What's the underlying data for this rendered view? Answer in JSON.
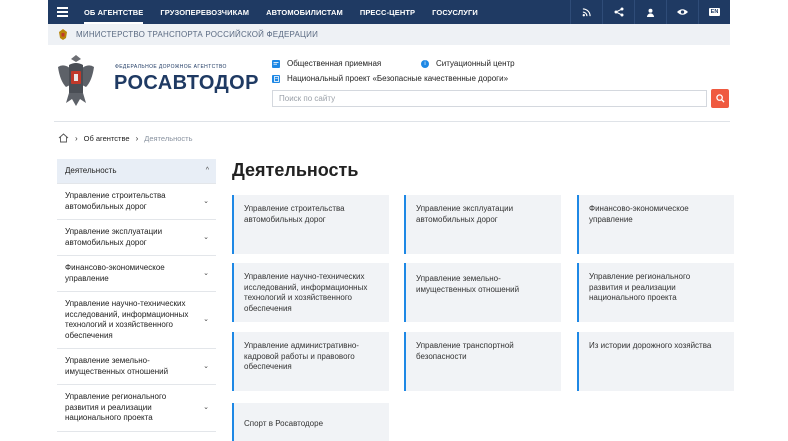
{
  "nav": {
    "items": [
      "ОБ АГЕНТСТВЕ",
      "ГРУЗОПЕРЕВОЗЧИКАМ",
      "АВТОМОБИЛИСТАМ",
      "ПРЕСС-ЦЕНТР",
      "ГОСУСЛУГИ"
    ],
    "lang": "EN"
  },
  "ministry": "МИНИСТЕРСТВО ТРАНСПОРТА РОССИЙСКОЙ ФЕДЕРАЦИИ",
  "header": {
    "logo_small": "ФЕДЕРАЛЬНОЕ ДОРОЖНОЕ АГЕНТСТВО",
    "logo_big": "РОСАВТОДОР",
    "link_reception": "Общественная приемная",
    "link_situation": "Ситуационный центр",
    "link_project": "Национальный проект «Безопасные качественные дороги»",
    "search_placeholder": "Поиск по сайту"
  },
  "breadcrumb": {
    "item1": "Об агентстве",
    "current": "Деятельность"
  },
  "sidebar": {
    "items": [
      "Деятельность",
      "Управление строительства автомобильных дорог",
      "Управление эксплуатации автомобильных дорог",
      "Финансово-экономическое управление",
      "Управление научно-технических исследований, информационных технологий и хозяйственного обеспечения",
      "Управление земельно-имущественных отношений",
      "Управление регионального развития и реализации национального проекта"
    ]
  },
  "main": {
    "title": "Деятельность",
    "cards": [
      "Управление строительства автомобильных дорог",
      "Управление эксплуатации автомобильных дорог",
      "Финансово-экономическое управление",
      "Управление научно-технических исследований, информационных технологий и хозяйственного обеспечения",
      "Управление земельно-имущественных отношений",
      "Управление регионального развития и реализации национального проекта",
      "Управление административно-кадровой работы и правового обеспечения",
      "Управление транспортной безопасности",
      "Из истории дорожного хозяйства",
      "Спорт в Росавтодоре"
    ]
  },
  "colors": {
    "nav_bg": "#1f3a63",
    "accent": "#1e88e5",
    "search_button": "#ef5a40"
  }
}
